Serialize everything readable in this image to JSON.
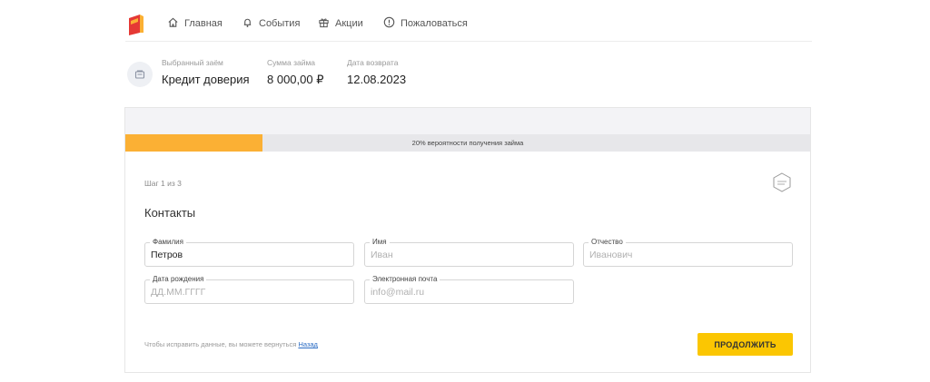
{
  "nav": {
    "items": [
      {
        "label": "Главная",
        "icon": "home-icon"
      },
      {
        "label": "События",
        "icon": "bell-icon"
      },
      {
        "label": "Акции",
        "icon": "gift-icon"
      },
      {
        "label": "Пожаловаться",
        "icon": "alert-circle-icon"
      }
    ],
    "logo_colors": {
      "primary": "#e53935",
      "accent": "#fbb034"
    }
  },
  "loan": {
    "icon": "wallet-icon",
    "selected_label": "Выбранный заём",
    "selected_value": "Кредит доверия",
    "amount_label": "Сумма займа",
    "amount_value": "8 000,00 ₽",
    "return_label": "Дата возврата",
    "return_value": "12.08.2023"
  },
  "progress": {
    "percent": 20,
    "text": "20% вероятности получения займа",
    "fill_color": "#fbb034"
  },
  "form": {
    "step": "Шаг 1 из 3",
    "title": "Контакты",
    "badge_icon": "secure-badge-icon",
    "fields": {
      "surname": {
        "label": "Фамилия",
        "value": "Петров",
        "placeholder": ""
      },
      "name": {
        "label": "Имя",
        "value": "",
        "placeholder": "Иван"
      },
      "patronymic": {
        "label": "Отчество",
        "value": "",
        "placeholder": "Иванович"
      },
      "birthdate": {
        "label": "Дата рождения",
        "value": "",
        "placeholder": "ДД.ММ.ГГГГ"
      },
      "email": {
        "label": "Электронная почта",
        "value": "",
        "placeholder": "info@mail.ru"
      }
    },
    "hint_text": "Чтобы исправить данные, вы можете вернуться",
    "back_link": "Назад",
    "continue_label": "ПРОДОЛЖИТЬ",
    "accent_color": "#fbc602"
  }
}
